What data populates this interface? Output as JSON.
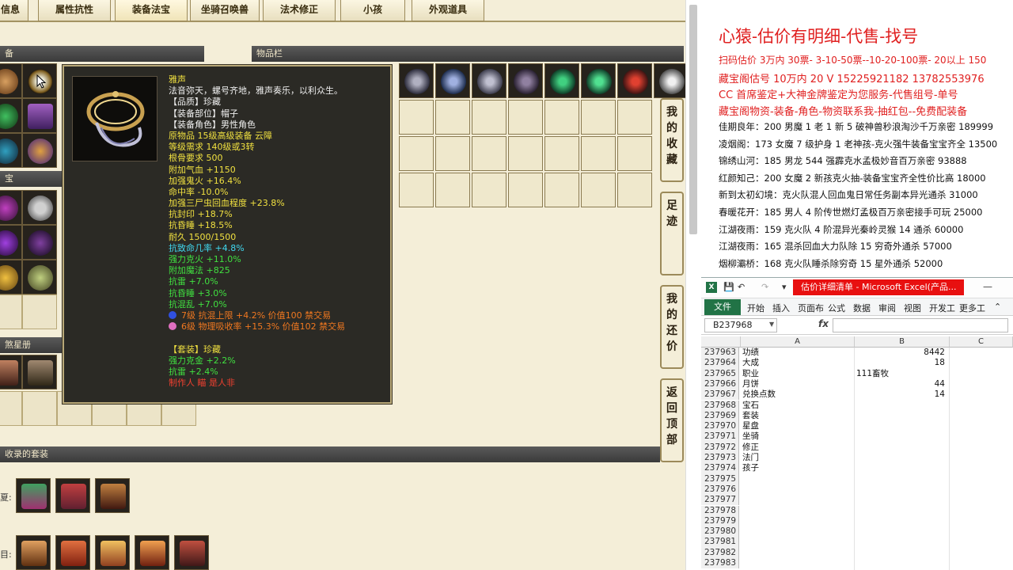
{
  "game": {
    "tabs": [
      {
        "label": "信息"
      },
      {
        "label": "属性抗性"
      },
      {
        "label": "装备法宝"
      },
      {
        "label": "坐骑召唤兽"
      },
      {
        "label": "法术修正"
      },
      {
        "label": "小孩"
      },
      {
        "label": "外观道具"
      }
    ],
    "panels": {
      "equip": "备",
      "treasure": "宝",
      "star_book": "煞星册",
      "inventory": "物品栏",
      "suits": "收录的套装"
    },
    "suit_rows": [
      "夏:",
      "目:"
    ],
    "side_buttons": [
      {
        "label": "我的收藏"
      },
      {
        "label": "足迹"
      },
      {
        "label": "我的还价"
      },
      {
        "label": "返回顶部"
      }
    ],
    "tooltip": {
      "lines": [
        {
          "text": "雅声",
          "color": "yellow"
        },
        {
          "text": "法音弥天，螺号齐地，雅声奏乐，以利众生。",
          "color": "white"
        },
        {
          "text": "【品质】珍藏",
          "color": "white"
        },
        {
          "text": "【装备部位】帽子",
          "color": "white"
        },
        {
          "text": "【装备角色】男性角色",
          "color": "white"
        },
        {
          "text": "原物品 15级高级装备 云障",
          "color": "yellow"
        },
        {
          "text": "等级需求 140级或3转",
          "color": "yellow"
        },
        {
          "text": "根骨要求 500",
          "color": "yellow"
        },
        {
          "text": "附加气血 +1150",
          "color": "yellow"
        },
        {
          "text": "加强鬼火 +16.4%",
          "color": "yellow"
        },
        {
          "text": "命中率 -10.0%",
          "color": "yellow"
        },
        {
          "text": "加强三尸虫回血程度 +23.8%",
          "color": "yellow"
        },
        {
          "text": "抗封印 +18.7%",
          "color": "yellow"
        },
        {
          "text": "抗昏睡 +18.5%",
          "color": "yellow"
        },
        {
          "text": "耐久 1500/1500",
          "color": "yellow"
        },
        {
          "text": "抗致命几率 +4.8%",
          "color": "cyan"
        },
        {
          "text": "强力克火 +11.0%",
          "color": "green"
        },
        {
          "text": "附加魔法 +825",
          "color": "green"
        },
        {
          "text": "抗雷 +7.0%",
          "color": "green"
        },
        {
          "text": "抗昏睡 +3.0%",
          "color": "green"
        },
        {
          "text": "抗混乱 +7.0%",
          "color": "green"
        },
        {
          "text": "7级 抗混上限 +4.2% 价值100 禁交易",
          "color": "orange",
          "gem": "#3050e0"
        },
        {
          "text": "6级 物理吸收率 +15.3% 价值102 禁交易",
          "color": "orange",
          "gem": "#e070c0"
        },
        {
          "text": "",
          "color": "white"
        },
        {
          "text": "【套装】珍藏",
          "color": "yellow"
        },
        {
          "text": "强力克金 +2.2%",
          "color": "green"
        },
        {
          "text": "抗雷 +2.4%",
          "color": "green"
        },
        {
          "text": "制作人 瞄 是人非",
          "color": "red"
        }
      ]
    }
  },
  "notes": {
    "title": "心猿-估价有明细-代售-找号",
    "promos": [
      "扫码估价 3万内 30票- 3-10-50票--10-20-100票- 20以上 150",
      "藏宝阁估号 10万内 20 V 15225921182    13782553976",
      "CC 首席鉴定+大神金牌鉴定为您服务-代售组号-单号",
      "藏宝阁物资-装备-角色-物资联系我-抽红包--免费配装备"
    ],
    "entries": [
      "佳期良年：200 男魔 1 老 1 新 5 破神兽秒浪淘沙千万亲密 189999",
      "凌烟阁：173 女魔 7 级护身 1 老神孩-克火强牛装备宝宝齐全 13500",
      "锦绣山河：185 男龙 544 强霹克水孟极妙音百万亲密 93888",
      "红颜知己：200 女魔 2 新孩克火抽-装备宝宝齐全性价比高 18000",
      "新到太初幻境：克火队混人回血鬼日常任务副本异光通杀 31000",
      "春暖花开：185 男人 4 阶传世燃灯孟极百万亲密接手可玩 25000",
      "江湖夜雨：159 克火队 4 阶混异光秦岭灵猴 14 通杀 60000",
      "江湖夜雨：165 混杀回血大力队除 15 穷奇外通杀 57000",
      "烟柳灞桥：168 克火队睡杀除穷奇 15 星外通杀 52000"
    ]
  },
  "excel": {
    "doc_title": "估价详细清单 - Microsoft Excel(产品...",
    "ribbon_tabs": [
      "文件",
      "开始",
      "插入",
      "页面布",
      "公式",
      "数据",
      "审阅",
      "视图",
      "开发工",
      "更多工"
    ],
    "name_box": "B237968",
    "fx": "fx",
    "columns": [
      "A",
      "B",
      "C"
    ],
    "rows": [
      {
        "n": "237963",
        "a": "功绩",
        "b": "8442",
        "b_num": true
      },
      {
        "n": "237964",
        "a": "大成",
        "b": "18",
        "b_num": true
      },
      {
        "n": "237965",
        "a": "职业",
        "b": "111畜牧",
        "b_num": false
      },
      {
        "n": "237966",
        "a": "月饼",
        "b": "44",
        "b_num": true
      },
      {
        "n": "237967",
        "a": "兑换点数",
        "b": "14",
        "b_num": true
      },
      {
        "n": "237968",
        "a": "宝石",
        "b": "",
        "b_num": false
      },
      {
        "n": "237969",
        "a": "套装",
        "b": "",
        "b_num": false
      },
      {
        "n": "237970",
        "a": "星盘",
        "b": "",
        "b_num": false
      },
      {
        "n": "237971",
        "a": "坐骑",
        "b": "",
        "b_num": false
      },
      {
        "n": "237972",
        "a": "修正",
        "b": "",
        "b_num": false
      },
      {
        "n": "237973",
        "a": "法门",
        "b": "",
        "b_num": false
      },
      {
        "n": "237974",
        "a": "孩子",
        "b": "",
        "b_num": false
      },
      {
        "n": "237975",
        "a": "",
        "b": "",
        "b_num": false
      },
      {
        "n": "237976",
        "a": "",
        "b": "",
        "b_num": false
      },
      {
        "n": "237977",
        "a": "",
        "b": "",
        "b_num": false
      },
      {
        "n": "237978",
        "a": "",
        "b": "",
        "b_num": false
      },
      {
        "n": "237979",
        "a": "",
        "b": "",
        "b_num": false
      },
      {
        "n": "237980",
        "a": "",
        "b": "",
        "b_num": false
      },
      {
        "n": "237981",
        "a": "",
        "b": "",
        "b_num": false
      },
      {
        "n": "237982",
        "a": "",
        "b": "",
        "b_num": false
      },
      {
        "n": "237983",
        "a": "",
        "b": "",
        "b_num": false
      }
    ]
  },
  "colors": {
    "accent_red": "#e02020",
    "excel_green": "#217346",
    "tooltip_bg": "#2b2a25"
  }
}
